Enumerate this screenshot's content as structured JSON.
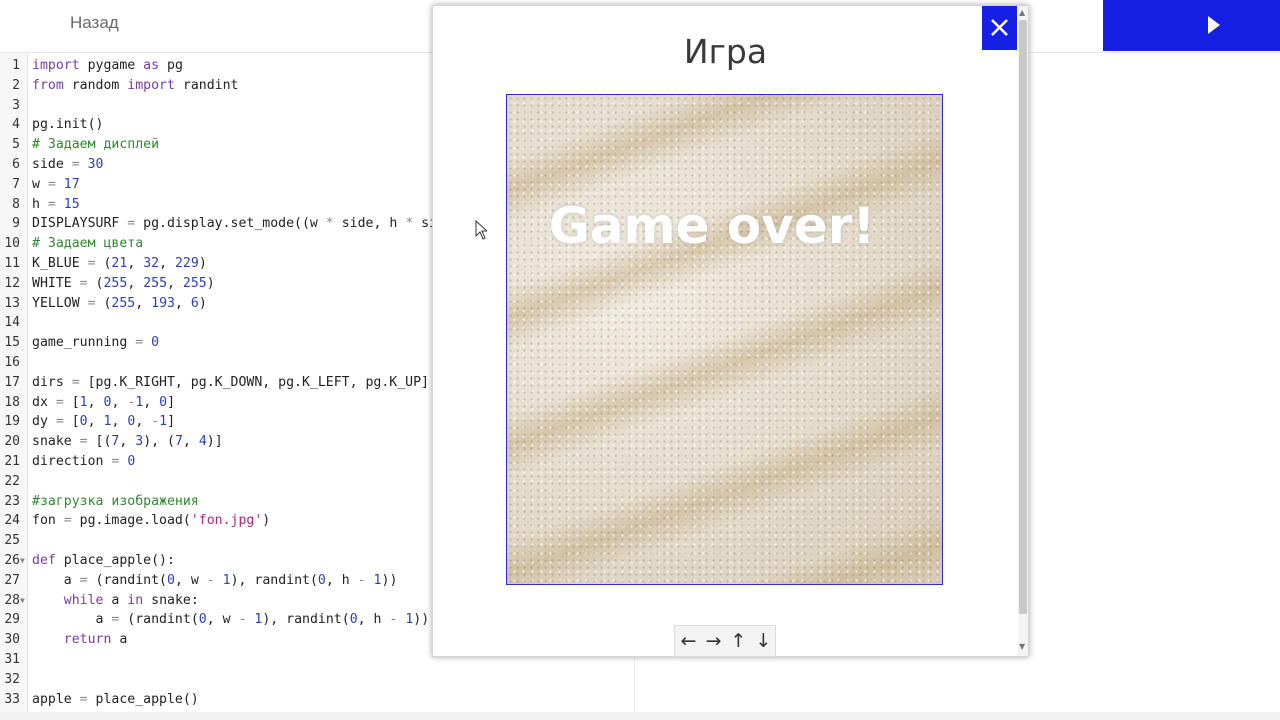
{
  "topbar": {
    "back_label": "Назад",
    "run_icon": "play-icon",
    "accent": "#1620e5"
  },
  "editor": {
    "lines": [
      {
        "n": "1",
        "t": "import pygame as pg"
      },
      {
        "n": "2",
        "t": "from random import randint"
      },
      {
        "n": "3",
        "t": ""
      },
      {
        "n": "4",
        "t": "pg.init()"
      },
      {
        "n": "5",
        "t": "# Задаем дисплей"
      },
      {
        "n": "6",
        "t": "side = 30"
      },
      {
        "n": "7",
        "t": "w = 17"
      },
      {
        "n": "8",
        "t": "h = 15"
      },
      {
        "n": "9",
        "t": "DISPLAYSURF = pg.display.set_mode((w * side, h * side"
      },
      {
        "n": "10",
        "t": "# Задаем цвета"
      },
      {
        "n": "11",
        "t": "K_BLUE = (21, 32, 229)"
      },
      {
        "n": "12",
        "t": "WHITE = (255, 255, 255)"
      },
      {
        "n": "13",
        "t": "YELLOW = (255, 193, 6)"
      },
      {
        "n": "14",
        "t": ""
      },
      {
        "n": "15",
        "t": "game_running = 0"
      },
      {
        "n": "16",
        "t": ""
      },
      {
        "n": "17",
        "t": "dirs = [pg.K_RIGHT, pg.K_DOWN, pg.K_LEFT, pg.K_UP]"
      },
      {
        "n": "18",
        "t": "dx = [1, 0, -1, 0]"
      },
      {
        "n": "19",
        "t": "dy = [0, 1, 0, -1]"
      },
      {
        "n": "20",
        "t": "snake = [(7, 3), (7, 4)]"
      },
      {
        "n": "21",
        "t": "direction = 0"
      },
      {
        "n": "22",
        "t": ""
      },
      {
        "n": "23",
        "t": "#загрузка изображения"
      },
      {
        "n": "24",
        "t": "fon = pg.image.load('fon.jpg')"
      },
      {
        "n": "25",
        "t": ""
      },
      {
        "n": "26",
        "t": "def place_apple():",
        "fold": true
      },
      {
        "n": "27",
        "t": "    a = (randint(0, w - 1), randint(0, h - 1))"
      },
      {
        "n": "28",
        "t": "    while a in snake:",
        "fold": true
      },
      {
        "n": "29",
        "t": "        a = (randint(0, w - 1), randint(0, h - 1))"
      },
      {
        "n": "30",
        "t": "    return a"
      },
      {
        "n": "31",
        "t": ""
      },
      {
        "n": "32",
        "t": ""
      },
      {
        "n": "33",
        "t": "apple = place_apple()"
      }
    ]
  },
  "game_window": {
    "title": "Игра",
    "close_icon": "close-icon",
    "message": "Game over!",
    "controls": [
      {
        "label": "←",
        "name": "arrow-left-button"
      },
      {
        "label": "→",
        "name": "arrow-right-button"
      },
      {
        "label": "↑",
        "name": "arrow-up-button"
      },
      {
        "label": "↓",
        "name": "arrow-down-button"
      }
    ]
  }
}
